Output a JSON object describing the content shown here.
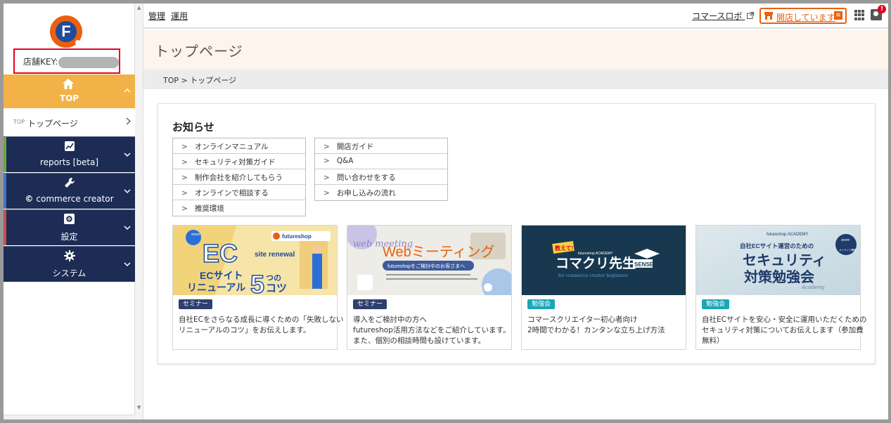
{
  "sidebar": {
    "logo_letter": "F",
    "shop_key_label": "店舗KEY:",
    "top": {
      "label": "TOP",
      "icon": "home-icon"
    },
    "top_page": {
      "prefix": "TOP",
      "label": "トップページ"
    },
    "items": [
      {
        "label": "reports [beta]",
        "icon": "chart-icon",
        "accent": "#6fa640"
      },
      {
        "label": "commerce creator",
        "prefix": "©",
        "icon": "wrench-icon",
        "accent": "#3b78c2"
      },
      {
        "label": "設定",
        "icon": "gear-box-icon",
        "accent": "#c0504d"
      },
      {
        "label": "システム",
        "icon": "gear-icon",
        "accent": "#1d2c55"
      }
    ]
  },
  "topbar": {
    "menu": [
      "管理",
      "運用"
    ],
    "commerce_robo": "コマースロボ",
    "open_status": "開店しています",
    "notification_badge": "!"
  },
  "page": {
    "title": "トップページ",
    "breadcrumb": "TOP > トップページ"
  },
  "notice": {
    "heading": "お知らせ",
    "left_links": [
      "オンラインマニュアル",
      "セキュリティ対策ガイド",
      "制作会社を紹介してもらう",
      "オンラインで相談する",
      "推奨環境"
    ],
    "right_links": [
      "開店ガイド",
      "Q&A",
      "問い合わせをする",
      "お申し込みの流れ"
    ]
  },
  "banners": [
    {
      "tag": "セミナー",
      "tag_color": "#2f3f6e",
      "image": {
        "brand": "futureshop",
        "line1": "EC",
        "line2": "site renewal",
        "line3": "ECサイト",
        "line4": "リニューアル",
        "line5": "5",
        "line6": "つの",
        "line7": "コツ",
        "badge": "zoom"
      },
      "desc": [
        "自社ECをさらなる成長に導くための「失敗しない",
        "リニューアルのコツ」をお伝えします。"
      ]
    },
    {
      "tag": "セミナー",
      "tag_color": "#2f3f6e",
      "image": {
        "line1": "Webミーティング",
        "line2": "web meeting",
        "line3": "futureshopをご検討中のお客さまへ"
      },
      "desc": [
        "導入をご検討中の方へ",
        "futureshop活用方法などをご紹介しています。",
        "また、個別の相談時間も設けています。"
      ]
    },
    {
      "tag": "勉強会",
      "tag_color": "#1aa6b7",
      "image": {
        "line1": "教えて!",
        "line2": "コマクリ先生",
        "line3": "SENSEI",
        "line4": "for commerce creator beginners",
        "line5": "futureshop ACADEMY"
      },
      "desc": [
        "コマースクリエイター初心者向け",
        "2時間でわかる！カンタンな立ち上げ方法"
      ]
    },
    {
      "tag": "勉強会",
      "tag_color": "#1aa6b7",
      "image": {
        "line1": "futureshop ACADEMY",
        "line2": "自社ECサイト運営のための",
        "line3": "セキュリティ",
        "line4": "対策勉強会",
        "line5": "Academy",
        "badge": "zoom",
        "badge2": "オンライン開催"
      },
      "desc": [
        "自社ECサイトを安心・安全に運用いただくための",
        "セキュリティ対策についてお伝えします（参加費",
        "無料）"
      ]
    }
  ]
}
